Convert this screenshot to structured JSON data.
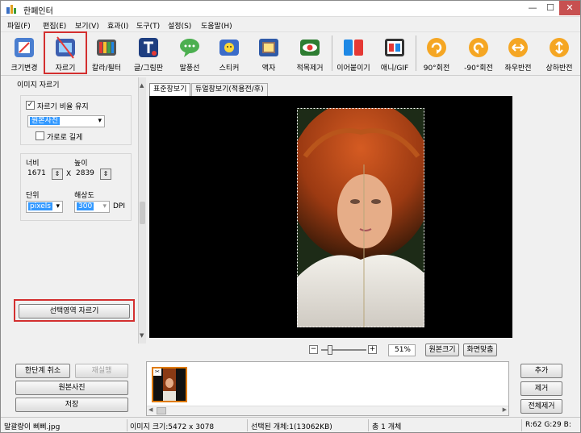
{
  "app": {
    "title": "한페인터"
  },
  "menu": [
    "파일(F)",
    "편집(E)",
    "보기(V)",
    "효과(I)",
    "도구(T)",
    "설정(S)",
    "도움말(H)"
  ],
  "toolbar": [
    "크기변경",
    "자르기",
    "칼라/필터",
    "글/그림판",
    "말풍선",
    "스티커",
    "액자",
    "적목제거",
    "이어붙이기",
    "애니/GIF",
    "90°회전",
    "-90°회전",
    "좌우반전",
    "상하반전"
  ],
  "crop": {
    "panel_title": "이미지 자르기",
    "keep_ratio": "자르기 비율 유지",
    "ratio_value": "원본사진",
    "landscape": "가로로 길게",
    "width_label": "너비",
    "width_value": "1671",
    "height_label": "높이",
    "height_value": "2839",
    "x": "X",
    "unit_label": "단위",
    "unit_value": "pixels",
    "dpi_label": "해상도",
    "dpi_value": "300",
    "dpi_unit": "DPI",
    "crop_button": "선택영역 자르기"
  },
  "actions": {
    "undo": "한단계 취소",
    "redo": "재실행",
    "original": "원본사진",
    "save": "저장"
  },
  "tabs": [
    "표준창보기",
    "듀얼창보기(적용전/후)"
  ],
  "zoom": {
    "minus": "−",
    "plus": "+",
    "percent": "51%",
    "original_size": "원본크기",
    "fit": "화면맞춤",
    "level": 0.15
  },
  "list_buttons": {
    "add": "추가",
    "remove": "제거",
    "remove_all": "전체제거"
  },
  "status": {
    "file": "말괄량이 삐삐.jpg",
    "size": "이미지 크기:5472 x 3078",
    "selected": "선택된 개체:1(13062KB)",
    "total": "총 1 개체",
    "rgb": "R:62 G:29 B:"
  },
  "colors": {
    "accent_red": "#d32f2f",
    "selection": "#3399ff",
    "close": "#c75050"
  }
}
